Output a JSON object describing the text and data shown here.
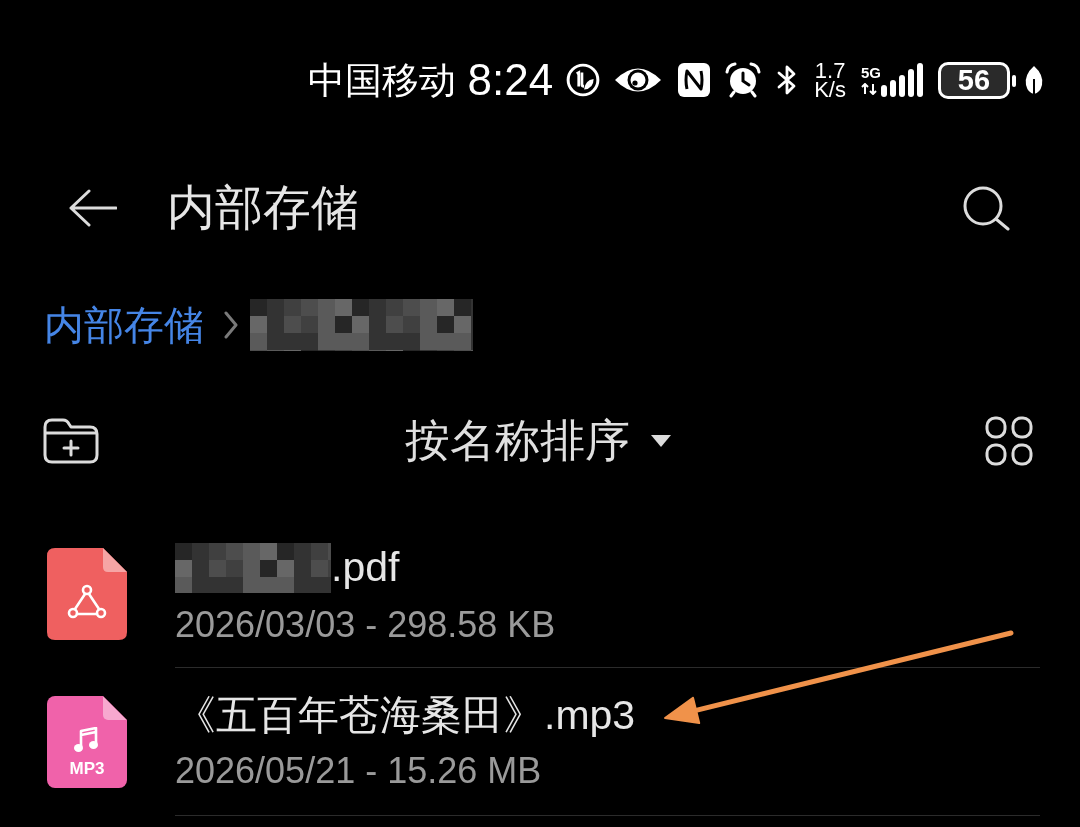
{
  "status_bar": {
    "carrier": "中国移动",
    "time": "8:24",
    "net_speed": "1.7",
    "net_speed_unit": "K/s",
    "network_type": "5G",
    "battery": "56"
  },
  "header": {
    "title": "内部存储"
  },
  "breadcrumb": [
    {
      "label": "内部存储"
    },
    {
      "redacted": true
    }
  ],
  "toolbar": {
    "sort_label": "按名称排序"
  },
  "files": [
    {
      "kind": "pdf",
      "redacted": true,
      "name": ".pdf",
      "meta": "2026/03/03 - 298.58 KB",
      "arrow": false
    },
    {
      "kind": "mp3",
      "icon_label": "MP3",
      "redacted": false,
      "name": "《五百年苍海桑田》.mp3",
      "meta": "2026/05/21 - 15.26 MB",
      "arrow": true
    }
  ]
}
